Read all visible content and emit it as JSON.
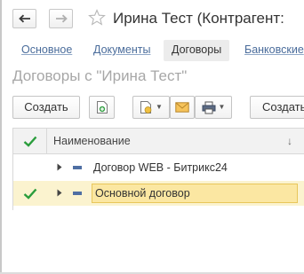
{
  "window": {
    "title": "Ирина Тест (Контрагент:",
    "back_icon": "arrow-left-icon",
    "forward_icon": "arrow-right-icon",
    "favorite_icon": "star-outline-icon"
  },
  "tabs": [
    {
      "label": "Основное",
      "state": "link"
    },
    {
      "label": "Документы",
      "state": "link"
    },
    {
      "label": "Договоры",
      "state": "active"
    },
    {
      "label": "Банковские",
      "state": "link"
    }
  ],
  "list": {
    "title": "Договоры с \"Ирина Тест\""
  },
  "toolbar": {
    "create_label": "Создать",
    "copy_icon": "create-copy-icon",
    "print_group_icon": "document-print-list-icon",
    "email_icon": "envelope-icon",
    "print_icon": "printer-icon",
    "create_based_label": "Создать"
  },
  "table": {
    "header_check_icon": "checkmark-icon",
    "column_name": "Наименование",
    "sort_icon": "sort-down-arrow-icon",
    "rows": [
      {
        "name": "Договор WEB - Битрикс24",
        "checked": false,
        "selected": false
      },
      {
        "name": "Основной договор",
        "checked": true,
        "selected": true
      }
    ]
  },
  "colors": {
    "link": "#4a6c9b",
    "check_green": "#2a9d3c",
    "selected_row": "#fbf3cf",
    "selected_cell": "#fbe7a2",
    "item_icon": "#4f6fa3"
  }
}
